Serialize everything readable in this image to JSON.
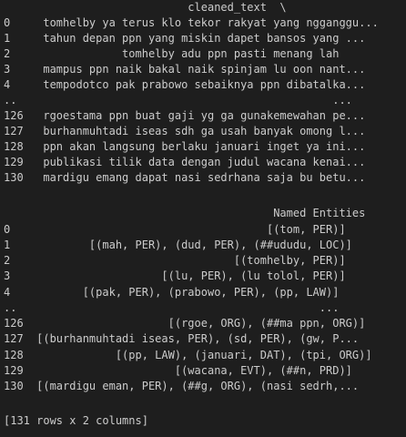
{
  "output": {
    "section1": {
      "header": "                            cleaned_text  \\",
      "rows": [
        "0     tomhelby ya terus klo tekor rakyat yang ngganggu...",
        "1     tahun depan ppn yang miskin dapet bansos yang ...",
        "2                 tomhelby adu ppn pasti menang lah",
        "3     mampus ppn naik bakal naik spinjam lu oon nant...",
        "4     tempodotco pak prabowo sebaiknya ppn dibatalka...",
        "..                                                ...",
        "126   rgoestama ppn buat gaji yg ga gunakemewahan pe...",
        "127   burhanmuhtadi iseas sdh ga usah banyak omong l...",
        "128   ppn akan langsung berlaku januari inget ya ini...",
        "129   publikasi tilik data dengan judul wacana kenai...",
        "130   mardigu emang dapat nasi sedrhana saja bu betu..."
      ]
    },
    "section2": {
      "header": "                                         Named Entities",
      "rows": [
        "0                                       [(tom, PER)]",
        "1            [(mah, PER), (dud, PER), (##ududu, LOC)]",
        "2                                  [(tomhelby, PER)]",
        "3                       [(lu, PER), (lu tolol, PER)]",
        "4           [(pak, PER), (prabowo, PER), (pp, LAW)]",
        "..                                              ...",
        "126                      [(rgoe, ORG), (##ma ppn, ORG)]",
        "127  [(burhanmuhtadi iseas, PER), (sd, PER), (gw, P...",
        "128              [(pp, LAW), (januari, DAT), (tpi, ORG)]",
        "129                       [(wacana, EVT), (##n, PRD)]",
        "130  [(mardigu eman, PER), (##g, ORG), (nasi sedrh,..."
      ]
    },
    "shape_line": "[131 rows x 2 columns]"
  }
}
